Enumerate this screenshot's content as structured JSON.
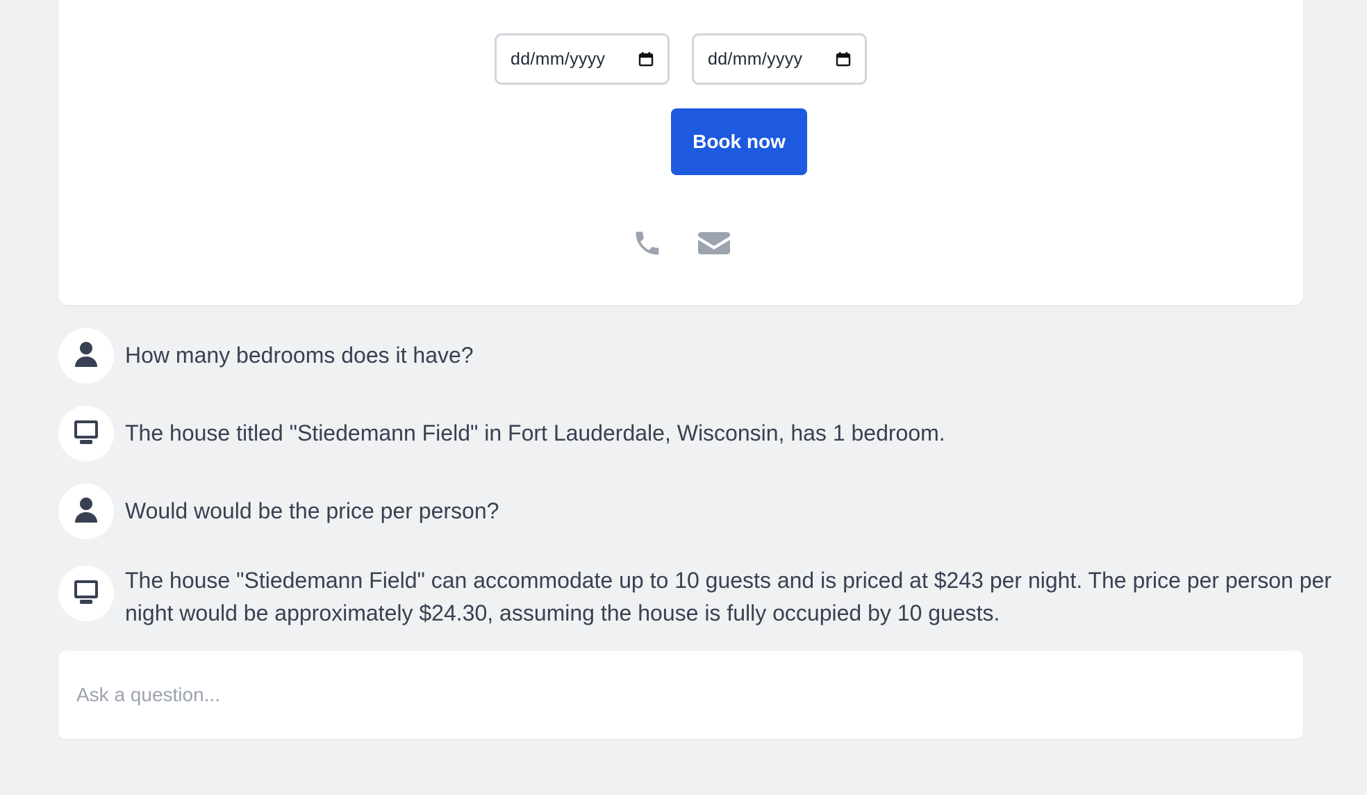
{
  "booking": {
    "check_in_placeholder": "dd/mm/yyyy",
    "check_out_placeholder": "dd/mm/yyyy",
    "book_button_label": "Book now",
    "contact_icons": [
      "phone-icon",
      "envelope-icon"
    ]
  },
  "chat": {
    "messages": [
      {
        "role": "user",
        "icon": "user-icon",
        "text": "How many bedrooms does it have?"
      },
      {
        "role": "assistant",
        "icon": "computer-icon",
        "text": "The house titled \"Stiedemann Field\" in Fort Lauderdale, Wisconsin, has 1 bedroom."
      },
      {
        "role": "user",
        "icon": "user-icon",
        "text": "Would would be the price per person?"
      },
      {
        "role": "assistant",
        "icon": "computer-icon",
        "text": "The house \"Stiedemann Field\" can accommodate up to 10 guests and is priced at $243 per night. The price per person per night would be approximately $24.30, assuming the house is fully occupied by 10 guests."
      }
    ],
    "input_placeholder": "Ask a question..."
  },
  "colors": {
    "page_background": "#f0f1f3",
    "card_background": "#ffffff",
    "primary_button": "#1d5ae0",
    "icon_gray": "#9ca3af",
    "avatar_icon": "#374151",
    "text": "#374151"
  }
}
